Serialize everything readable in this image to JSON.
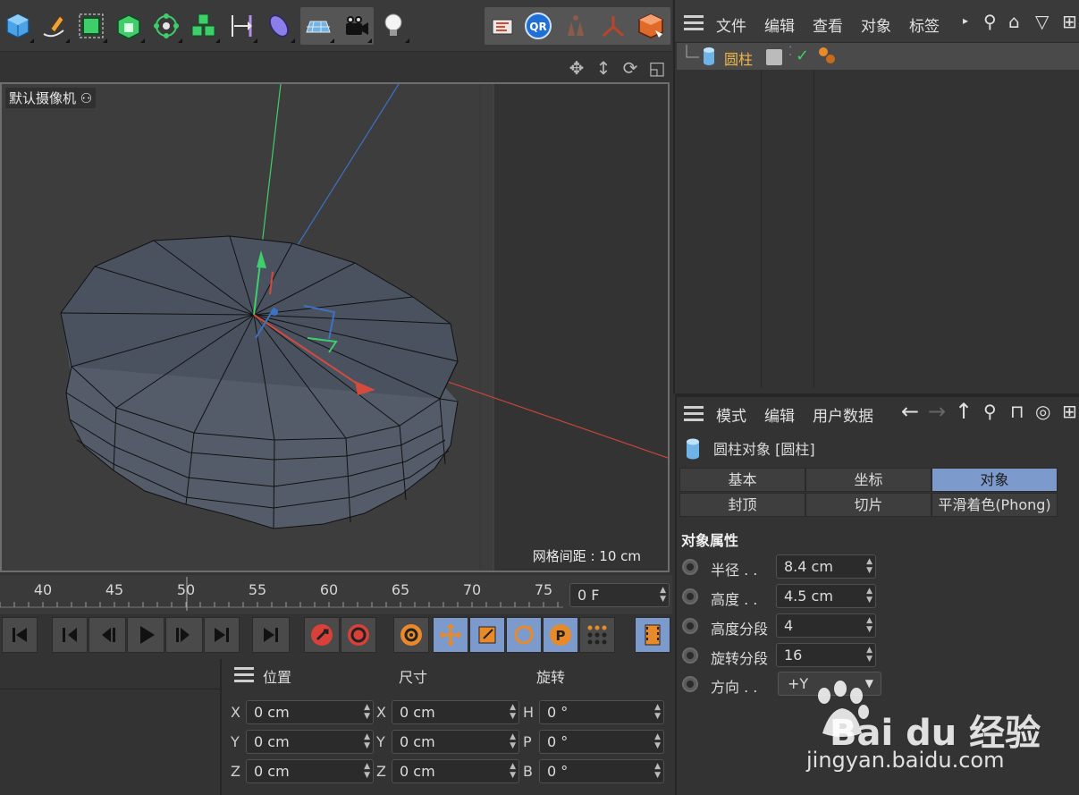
{
  "toolbar": {
    "left_tools": [
      "cube-primitive",
      "pen-spline",
      "subdivision-nurbs",
      "array-cloner",
      "deformer-mesh",
      "scene-cubes",
      "symmetry",
      "deformer-bend",
      "floor-plane",
      "camera",
      "light"
    ],
    "right_tools": [
      "render-settings",
      "qr-tool",
      "snap-gray",
      "axis-tool",
      "render-picture"
    ]
  },
  "viewport": {
    "camera_label": "默认摄像机",
    "grid_spacing": "网格间距 : 10 cm",
    "nav_icons": [
      "move-view-icon",
      "dolly-view-icon",
      "rotate-view-icon",
      "maximize-view-icon"
    ]
  },
  "timeline": {
    "ticks": [
      "40",
      "45",
      "50",
      "55",
      "60",
      "65",
      "70",
      "75"
    ],
    "current_frame": "0 F"
  },
  "object_manager": {
    "menu": [
      "文件",
      "编辑",
      "查看",
      "对象",
      "标签"
    ],
    "object_name": "圆柱"
  },
  "attribute_manager": {
    "menu": [
      "模式",
      "编辑",
      "用户数据"
    ],
    "title": "圆柱对象 [圆柱]",
    "tabs_row1": [
      "基本",
      "坐标",
      "对象"
    ],
    "tabs_row2": [
      "封顶",
      "切片",
      "平滑着色(Phong)"
    ],
    "active_tab": "对象",
    "section": "对象属性",
    "properties": [
      {
        "label": "半径 . .",
        "value": "8.4 cm"
      },
      {
        "label": "高度 . .",
        "value": "4.5 cm"
      },
      {
        "label": "高度分段",
        "value": "4"
      },
      {
        "label": "旋转分段",
        "value": "16"
      }
    ],
    "orientation_label": "方向 . .",
    "orientation_value": "+Y"
  },
  "coordinates": {
    "headers": [
      "位置",
      "尺寸",
      "旋转"
    ],
    "position": {
      "X": "0 cm",
      "Y": "0 cm",
      "Z": "0 cm"
    },
    "size": {
      "X": "0 cm",
      "Y": "0 cm",
      "Z": "0 cm"
    },
    "rotation": {
      "H": "0 °",
      "P": "0 °",
      "B": "0 °"
    }
  },
  "watermark": {
    "brand": "Bai du 经验",
    "url": "jingyan.baidu.com"
  },
  "colors": {
    "accent_tab": "#7c9acb",
    "object_name": "#f0b847",
    "viewport_bg": "#3d3d3d",
    "panel_bg": "#333333"
  }
}
